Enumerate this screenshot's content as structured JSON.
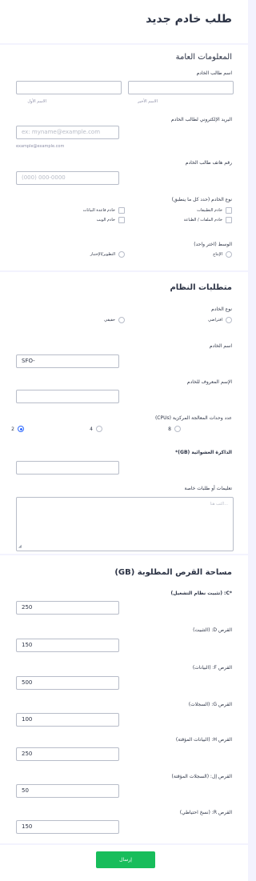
{
  "header": {
    "title": "طلب خادم جديد"
  },
  "general": {
    "title": "المعلومات العامة",
    "requester_name_label": "اسم طالب الخادم",
    "first_name_sublabel": "الاسم الأول",
    "last_name_sublabel": "الاسم الأخير",
    "email_label": "البريد الإلكتروني لطالب الخادم",
    "email_placeholder": "ex: myname@example.com",
    "email_sublabel": "example@example.com",
    "phone_label": "رقم هاتف طالب الخادم",
    "phone_placeholder": "(000) 000-0000",
    "server_type_label": "نوع الخادم (حدد كل ما ينطبق)",
    "server_type_options": [
      "خادم قاعدة البيانات",
      "خادم التطبيقات",
      "خادم الويب",
      "خادم الملفات / الطباعة"
    ],
    "environment_label": "الوسط (اختر واحد)",
    "environment_options": [
      "التطوير/الإختبار",
      "الإنتاج"
    ]
  },
  "system": {
    "title": "متطلبات النظام",
    "server_kind_label": "نوع الخادم",
    "server_kind_options": [
      "حقيقي",
      "افتراضي"
    ],
    "server_name_label": "اسم الخادم",
    "server_name_value": "SFO-",
    "alias_label": "الإسم المعروف للخادم",
    "alias_value": "",
    "cpu_label": "عدد وحدات المعالجة المركزية (CPUs)",
    "cpu_options": [
      "2",
      "4",
      "8"
    ],
    "cpu_selected": "2",
    "memory_label": "الذاكرة العشوائية (GB)*",
    "memory_value": "",
    "instructions_label": "تعليمات أو طلبات خاصة",
    "instructions_placeholder": "...اكتب هنا"
  },
  "disk": {
    "title": "مساحة القرص المطلوبة (GB)",
    "fields": [
      {
        "label": "*C: (تثبيت نظام التشغيل)",
        "value": "250"
      },
      {
        "label": "القرص D: (التثبيت)",
        "value": "150"
      },
      {
        "label": "القرص F: (البيانات)",
        "value": "500"
      },
      {
        "label": "القرص G: (السجلات)",
        "value": "100"
      },
      {
        "label": "القرص H: (البيانات المؤقتة)",
        "value": "250"
      },
      {
        "label": "القرص إل: (السجلات المؤقتة)",
        "value": "50"
      },
      {
        "label": "القرص R: (نسخ احتياطي)",
        "value": "150"
      }
    ]
  },
  "submit": {
    "label": "إرسال"
  },
  "colors": {
    "accent": "#2e69ff",
    "submit": "#18bd5b",
    "background": "#f3f3fe"
  }
}
